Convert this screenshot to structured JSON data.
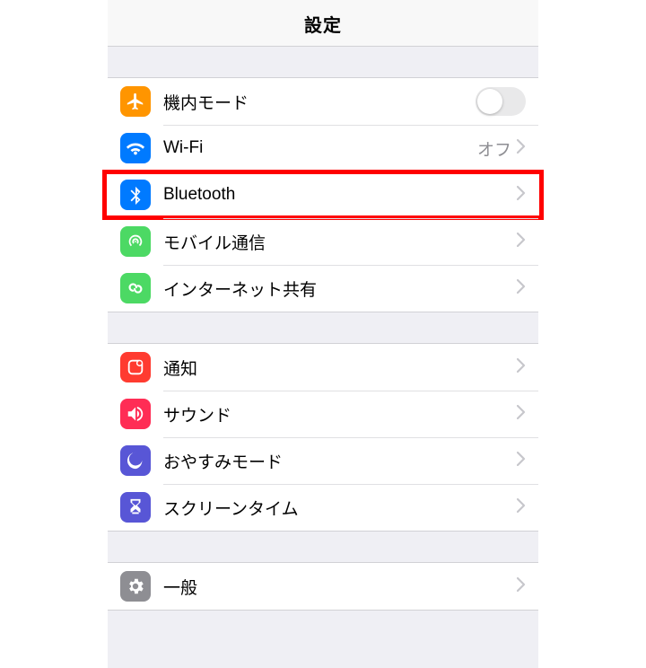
{
  "header": {
    "title": "設定"
  },
  "group1": {
    "airplane": {
      "label": "機内モード",
      "toggle_on": false
    },
    "wifi": {
      "label": "Wi-Fi",
      "value": "オフ"
    },
    "bluetooth": {
      "label": "Bluetooth"
    },
    "cellular": {
      "label": "モバイル通信"
    },
    "hotspot": {
      "label": "インターネット共有"
    }
  },
  "group2": {
    "notifications": {
      "label": "通知"
    },
    "sounds": {
      "label": "サウンド"
    },
    "dnd": {
      "label": "おやすみモード"
    },
    "screentime": {
      "label": "スクリーンタイム"
    }
  },
  "group3": {
    "general": {
      "label": "一般"
    }
  },
  "highlight": "bluetooth"
}
